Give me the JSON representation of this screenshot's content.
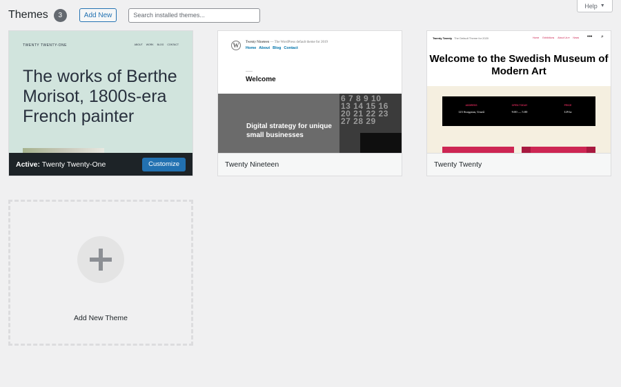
{
  "header": {
    "title": "Themes",
    "count": "3",
    "add_new_label": "Add New",
    "search_placeholder": "Search installed themes..."
  },
  "help": {
    "label": "Help",
    "arrow": "▼"
  },
  "themes": [
    {
      "name": "Twenty Twenty-One",
      "active_label": "Active:",
      "customize_label": "Customize",
      "preview": {
        "site_title": "TWENTY TWENTY-ONE",
        "nav": [
          "ABOUT",
          "WORK",
          "BLOG",
          "CONTACT"
        ],
        "headline": "The works of Berthe Morisot, 1800s-era French painter"
      }
    },
    {
      "name": "Twenty Nineteen",
      "preview": {
        "logo": "W",
        "site_title": "Twenty Nineteen",
        "tagline": "— The WordPress default theme for 2019",
        "nav": [
          "Home",
          "About",
          "Blog",
          "Contact"
        ],
        "welcome": "Welcome",
        "banner": "Digital strategy for unique small businesses",
        "calendar": "6 7 8 9 10\n13 14 15 16\n20 21 22 23\n27 28 29"
      }
    },
    {
      "name": "Twenty Twenty",
      "preview": {
        "site_title": "Twenty Twenty",
        "tagline": "The Default Theme for 2020",
        "nav": [
          "Home",
          "Exhibitions",
          "About Us ▾",
          "News"
        ],
        "menu_icon": "•••",
        "search_icon": "⌕",
        "headline": "Welcome to the Swedish Museum of Modern Art",
        "info": [
          {
            "label": "ADDRESS",
            "value": "123 Storgatan, Umeå"
          },
          {
            "label": "OPEN TODAY",
            "value": "9:00 — 5:00"
          },
          {
            "label": "PRICE",
            "value": "129 kr"
          }
        ]
      }
    }
  ],
  "add_theme": {
    "label": "Add New Theme"
  },
  "colors": {
    "accent": "#2271b1",
    "active_bar": "#1d2327",
    "badge": "#646970",
    "t1_bg": "#d1e4dd",
    "t3_red": "#cd2653"
  }
}
